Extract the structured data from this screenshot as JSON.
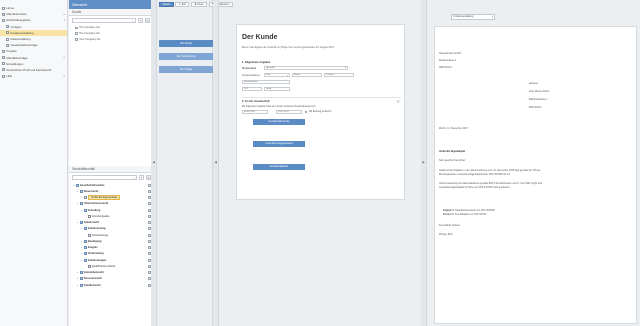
{
  "nav": {
    "items": [
      {
        "label": "Home",
        "sub": false,
        "active": false,
        "caret": ""
      },
      {
        "label": "Mandantenhaus",
        "sub": false,
        "active": false,
        "caret": ">"
      },
      {
        "label": "Erbschaftsregisters",
        "sub": false,
        "active": false,
        "caret": "v"
      },
      {
        "label": "Vorlagen",
        "sub": true,
        "active": false,
        "caret": ""
      },
      {
        "label": "Kundenverwaltung",
        "sub": true,
        "active": true,
        "caret": ""
      },
      {
        "label": "Dateiverwaltung",
        "sub": true,
        "active": false,
        "caret": ""
      },
      {
        "label": "Gesellschaftsverträge",
        "sub": true,
        "active": false,
        "caret": ""
      },
      {
        "label": "Projekte",
        "sub": false,
        "active": false,
        "caret": ""
      },
      {
        "label": "Mandatsverträge",
        "sub": false,
        "active": false,
        "caret": ">"
      },
      {
        "label": "Einstellungen",
        "sub": false,
        "active": false,
        "caret": ""
      },
      {
        "label": "Persönliches Profil und Kanzleiprofil",
        "sub": false,
        "active": false,
        "caret": ""
      },
      {
        "label": "Hilfe",
        "sub": false,
        "active": false,
        "caret": ">"
      }
    ]
  },
  "overview": {
    "header": "Übersicht",
    "subheader": "Kunde",
    "search_icon": "search-icon",
    "rows": [
      "The Company AG",
      "The Company AG",
      "Your Company AG"
    ]
  },
  "tree": {
    "subheader": "Geschäftsvorfall",
    "rows": [
      {
        "label": "Gesellschaftsrechte",
        "level": 0,
        "folder": true,
        "bold": true,
        "sel": false
      },
      {
        "label": "Steuerrecht",
        "level": 1,
        "folder": true,
        "bold": true,
        "sel": false
      },
      {
        "label": "Verdeckte Eigenanlage",
        "level": 2,
        "folder": false,
        "bold": false,
        "sel": true
      },
      {
        "label": "Unternehmensrecht",
        "level": 1,
        "folder": true,
        "bold": true,
        "sel": false
      },
      {
        "label": "Gründung",
        "level": 2,
        "folder": true,
        "bold": true,
        "sel": false
      },
      {
        "label": "Gründungsakte",
        "level": 3,
        "folder": false,
        "bold": false,
        "sel": false
      },
      {
        "label": "Arbeitsrecht",
        "level": 1,
        "folder": true,
        "bold": true,
        "sel": false
      },
      {
        "label": "Arbeitsvertrag",
        "level": 2,
        "folder": true,
        "bold": true,
        "sel": false
      },
      {
        "label": "Arbeitsvertrag",
        "level": 3,
        "folder": false,
        "bold": false,
        "sel": false
      },
      {
        "label": "Kündigung",
        "level": 2,
        "folder": true,
        "bold": true,
        "sel": false
      },
      {
        "label": "Zeugnis",
        "level": 2,
        "folder": true,
        "bold": true,
        "sel": false
      },
      {
        "label": "Verabredung",
        "level": 2,
        "folder": true,
        "bold": true,
        "sel": false
      },
      {
        "label": "Arbeitszeugnis",
        "level": 2,
        "folder": true,
        "bold": true,
        "sel": false
      },
      {
        "label": "Qualifiziertes Arbeits",
        "level": 3,
        "folder": false,
        "bold": false,
        "sel": false
      },
      {
        "label": "Immobilienrecht",
        "level": 1,
        "folder": true,
        "bold": true,
        "sel": false
      },
      {
        "label": "Personenrecht",
        "level": 1,
        "folder": true,
        "bold": true,
        "sel": false
      },
      {
        "label": "Familienrecht",
        "level": 1,
        "folder": true,
        "bold": true,
        "sel": false
      }
    ]
  },
  "middle": {
    "buttons": [
      "Der Kunde",
      "Zur Verarbeitung",
      "Der Anlage"
    ]
  },
  "toolbar": {
    "save_label": "Speich",
    "buttons": [
      "Exit",
      "Neue",
      "Aktualisieren"
    ]
  },
  "doc": {
    "title": "Der Kunde",
    "lead": "Bevor man Eigene die Ursache im Pflege Ihrer unterzugeordneten 16. August 2017.",
    "section1": "1.  Allgemeine Angaben",
    "firm_label": "Firmenname",
    "firm_value": "Spenden",
    "address_label": "Ansprechpartner",
    "salutation_value": "Frau",
    "first_name": "Name",
    "last_name": "Zuname",
    "street_label": "Straße/Hausnr",
    "zip": "PLZ",
    "city": "Stadt",
    "section2": "2.  Art der Gesellschaft",
    "sec2_text": "Mit folgender Angaben bitte wir einzeln Gesamte Kundenhinweis vom",
    "date_from": "06.06.1991",
    "date_to": "15.02.2017",
    "check_text": "Mit Endung weiterhin",
    "buttons": [
      "Gesellschaftsvertrag",
      "Unternehmensgegenstand",
      "Gesellschafterliste"
    ]
  },
  "preview": {
    "select_value": "Kundenverwaltung",
    "company": "Steuerberater GmbH",
    "street": "Musterstrasse 3",
    "city": "0000 Zürich",
    "recipient": [
      "Adresse",
      "Frau Muster Zürich",
      "Bahnhofstrasse 1",
      "8000 Zürich"
    ],
    "date": "Zürich, 13. November 2017",
    "subject": "Verdeckte Eigenkapital",
    "salutation": "Sehr geehrte Frau Zuber",
    "body": [
      "Aufgrund der Angaben in der Jahresrechnung vom 31. Dezember 2016 liegt gemäss Art. 65 des",
      "Bundesgesetzes verdecktes Eigenkapital über CHF 300'000.00 vor.",
      "Unter Anwendung des Maximalsatzes gemäss ESTV Rundschreiben vom 6. Juni 1997 ergibt sich",
      "verdecktes Eigenkapital in Höhe von CHF 470'000 nicht anerkannt."
    ],
    "list": [
      {
        "bold": "Kapital",
        "rest": " für Hauptbuchsumsatz von CHF 300'000"
      },
      {
        "bold": "Zinsen",
        "rest": " für Fremdkapital von CHF 51'971"
      }
    ],
    "closing": "Freundliche Grüsse",
    "signature": "Phleger Bern"
  }
}
